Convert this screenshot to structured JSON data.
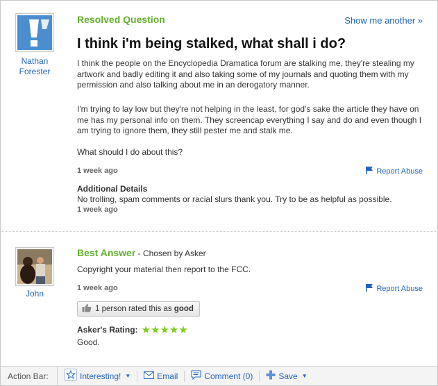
{
  "question": {
    "header": "Resolved Question",
    "show_another": "Show me another »",
    "title": "I think i'm being stalked, what shall i do?",
    "asker_name_line1": "Nathan",
    "asker_name_line2": "Forester",
    "body_p1": "I think the people on the Encyclopedia Dramatica forum are stalking me, they're stealing my artwork and badly editing it and also taking some of my journals and quoting them with my permission and also talking about me in an derogatory manner.",
    "body_p2": "I'm trying to lay low but they're not helping in the least, for god's sake the article they have on me has my personal info on them. They screencap everything I say and do and even though I am trying to ignore them, they still pester me and stalk me.",
    "body_p3": "What should I do about this?",
    "time": "1 week ago",
    "report_abuse": "Report Abuse",
    "details_heading": "Additional Details",
    "details_text": "No trolling, spam comments or racial slurs thank you. Try to be as helpful as possible.",
    "details_time": "1 week ago"
  },
  "answer": {
    "header": "Best Answer",
    "chosen_by": " - Chosen by Asker",
    "answerer_name": "John",
    "text": "Copyright your material then report to the FCC.",
    "time": "1 week ago",
    "report_abuse": "Report Abuse",
    "rated_count": "1 person rated this as ",
    "rated_value": "good",
    "askers_rating_label": "Asker's Rating:",
    "stars": "★★★★★",
    "rating_comment": "Good."
  },
  "action_bar": {
    "label": "Action Bar:",
    "interesting": "Interesting!",
    "email": "Email",
    "comment": "Comment (0)",
    "save": "Save"
  },
  "colors": {
    "accent_green": "#62b02e",
    "link_blue": "#2266bb",
    "star_green": "#7fcc1f"
  }
}
